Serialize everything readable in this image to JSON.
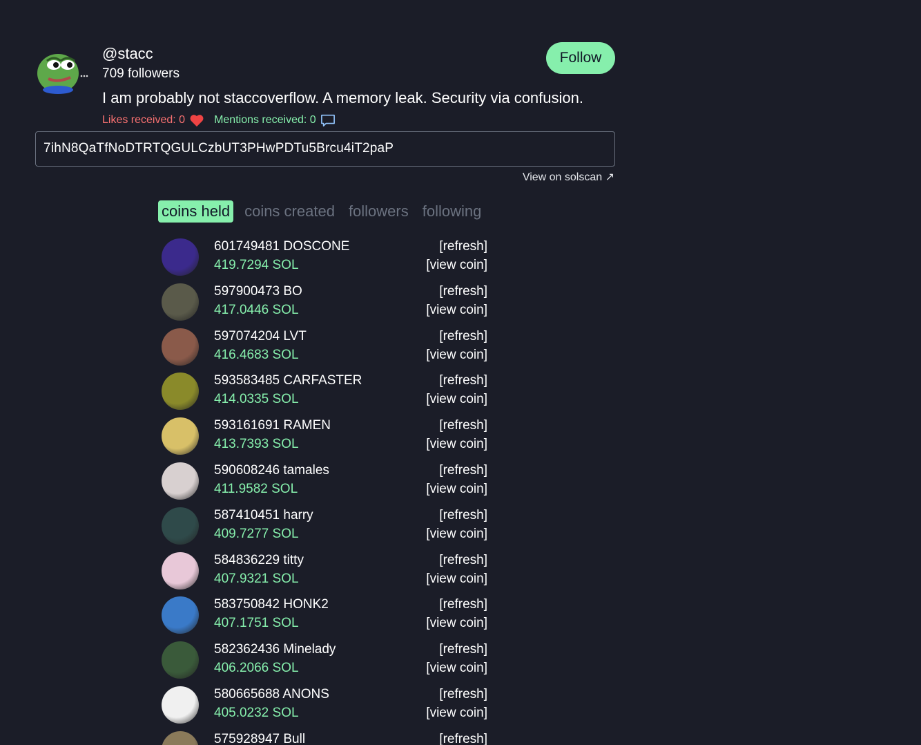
{
  "profile": {
    "handle": "@stacc",
    "followers": "709 followers",
    "bio": "I am probably not staccoverflow. A memory leak. Security via confusion.",
    "likes": "Likes received: 0",
    "mentions": "Mentions received: 0",
    "follow_label": "Follow",
    "address": "7ihN8QaTfNoDTRTQGULCzbUT3PHwPDTu5Brcu4iT2paP",
    "solscan_label": "View on solscan ↗"
  },
  "tabs": [
    {
      "label": "coins held",
      "active": true
    },
    {
      "label": "coins created",
      "active": false
    },
    {
      "label": "followers",
      "active": false
    },
    {
      "label": "following",
      "active": false
    }
  ],
  "coins": [
    {
      "name": "601749481 DOSCONE",
      "sol": "419.7294 SOL",
      "refresh": "[refresh]",
      "view": "[view coin]",
      "icon": "doscone-coin-icon",
      "color": "#3b2a8c"
    },
    {
      "name": "597900473 BO",
      "sol": "417.0446 SOL",
      "refresh": "[refresh]",
      "view": "[view coin]",
      "icon": "bo-coin-icon",
      "color": "#5a5a4a"
    },
    {
      "name": "597074204 LVT",
      "sol": "416.4683 SOL",
      "refresh": "[refresh]",
      "view": "[view coin]",
      "icon": "lvt-coin-icon",
      "color": "#8a5a4a"
    },
    {
      "name": "593583485 CARFASTER",
      "sol": "414.0335 SOL",
      "refresh": "[refresh]",
      "view": "[view coin]",
      "icon": "carfaster-coin-icon",
      "color": "#8a8a2a"
    },
    {
      "name": "593161691 RAMEN",
      "sol": "413.7393 SOL",
      "refresh": "[refresh]",
      "view": "[view coin]",
      "icon": "ramen-coin-icon",
      "color": "#d8c068"
    },
    {
      "name": "590608246 tamales",
      "sol": "411.9582 SOL",
      "refresh": "[refresh]",
      "view": "[view coin]",
      "icon": "tamales-coin-icon",
      "color": "#d8d0d0"
    },
    {
      "name": "587410451 harry",
      "sol": "409.7277 SOL",
      "refresh": "[refresh]",
      "view": "[view coin]",
      "icon": "harry-coin-icon",
      "color": "#2f4a4a"
    },
    {
      "name": "584836229 titty",
      "sol": "407.9321 SOL",
      "refresh": "[refresh]",
      "view": "[view coin]",
      "icon": "titty-coin-icon",
      "color": "#e8c8d8"
    },
    {
      "name": "583750842 HONK2",
      "sol": "407.1751 SOL",
      "refresh": "[refresh]",
      "view": "[view coin]",
      "icon": "honk2-coin-icon",
      "color": "#3a7ac8"
    },
    {
      "name": "582362436 Minelady",
      "sol": "406.2066 SOL",
      "refresh": "[refresh]",
      "view": "[view coin]",
      "icon": "minelady-coin-icon",
      "color": "#3a5a3a"
    },
    {
      "name": "580665688 ANONS",
      "sol": "405.0232 SOL",
      "refresh": "[refresh]",
      "view": "[view coin]",
      "icon": "anons-coin-icon",
      "color": "#f0f0f0"
    },
    {
      "name": "575928947 Bull",
      "sol": "",
      "refresh": "[refresh]",
      "view": "",
      "icon": "bull-coin-icon",
      "color": "#8a7a5a"
    }
  ],
  "colors": {
    "background": "#1b1d28",
    "accent": "#86efac",
    "likes": "#f87171",
    "muted_tab": "#6b7280"
  }
}
